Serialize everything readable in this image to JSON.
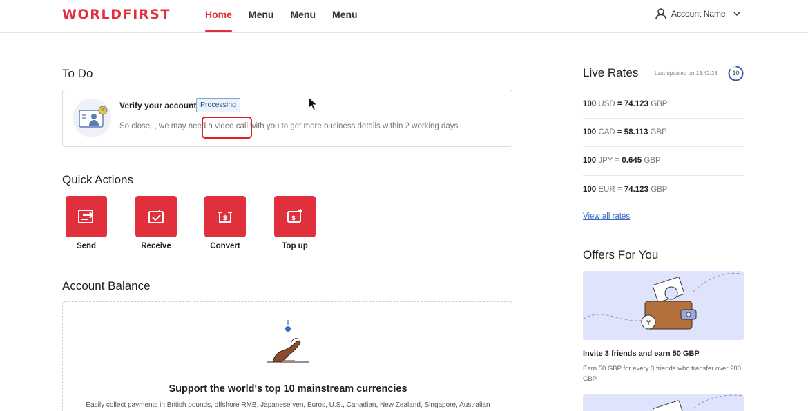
{
  "header": {
    "logo": "WORLDFIRST",
    "nav": [
      {
        "label": "Home",
        "active": true
      },
      {
        "label": "Menu",
        "active": false
      },
      {
        "label": "Menu",
        "active": false
      },
      {
        "label": "Menu",
        "active": false
      }
    ],
    "account_name": "Account Name"
  },
  "todo": {
    "title": "To Do",
    "item_title": "Verify your account",
    "status_badge": "Processing",
    "description": "So close, , we may need a video call with you to get more business details within 2 working days"
  },
  "quick_actions": {
    "title": "Quick Actions",
    "items": [
      {
        "label": "Send",
        "icon": "send-icon"
      },
      {
        "label": "Receive",
        "icon": "receive-icon"
      },
      {
        "label": "Convert",
        "icon": "convert-icon"
      },
      {
        "label": "Top up",
        "icon": "top-up-icon"
      }
    ]
  },
  "balance": {
    "title": "Account Balance",
    "heading": "Support the world's top 10 mainstream currencies",
    "subtext": "Easily collect payments in British pounds, offshore RMB, Japanese yen, Euros, U.S., Canadian, New Zealand, Singapore, Australian"
  },
  "rates": {
    "title": "Live Rates",
    "last_updated": "Last updated on 13:42:28",
    "countdown": "10",
    "items": [
      {
        "amount": "100",
        "from": "USD",
        "eq": "=",
        "value": "74.123",
        "to": "GBP"
      },
      {
        "amount": "100",
        "from": "CAD",
        "eq": "=",
        "value": "58.113",
        "to": "GBP"
      },
      {
        "amount": "100",
        "from": "JPY",
        "eq": "=",
        "value": "0.645",
        "to": "GBP"
      },
      {
        "amount": "100",
        "from": "EUR",
        "eq": "=",
        "value": "74.123",
        "to": "GBP"
      }
    ],
    "view_all": "View all rates"
  },
  "offers": {
    "title": "Offers For You",
    "items": [
      {
        "title": "Invite 3 friends and earn 50 GBP",
        "description": "Earn 50 GBP for every 3 friends who transfer over 200 GBP."
      }
    ]
  },
  "colors": {
    "brand": "#e0303c",
    "link": "#3a6bc4",
    "offer_bg": "#dfe3fb"
  }
}
